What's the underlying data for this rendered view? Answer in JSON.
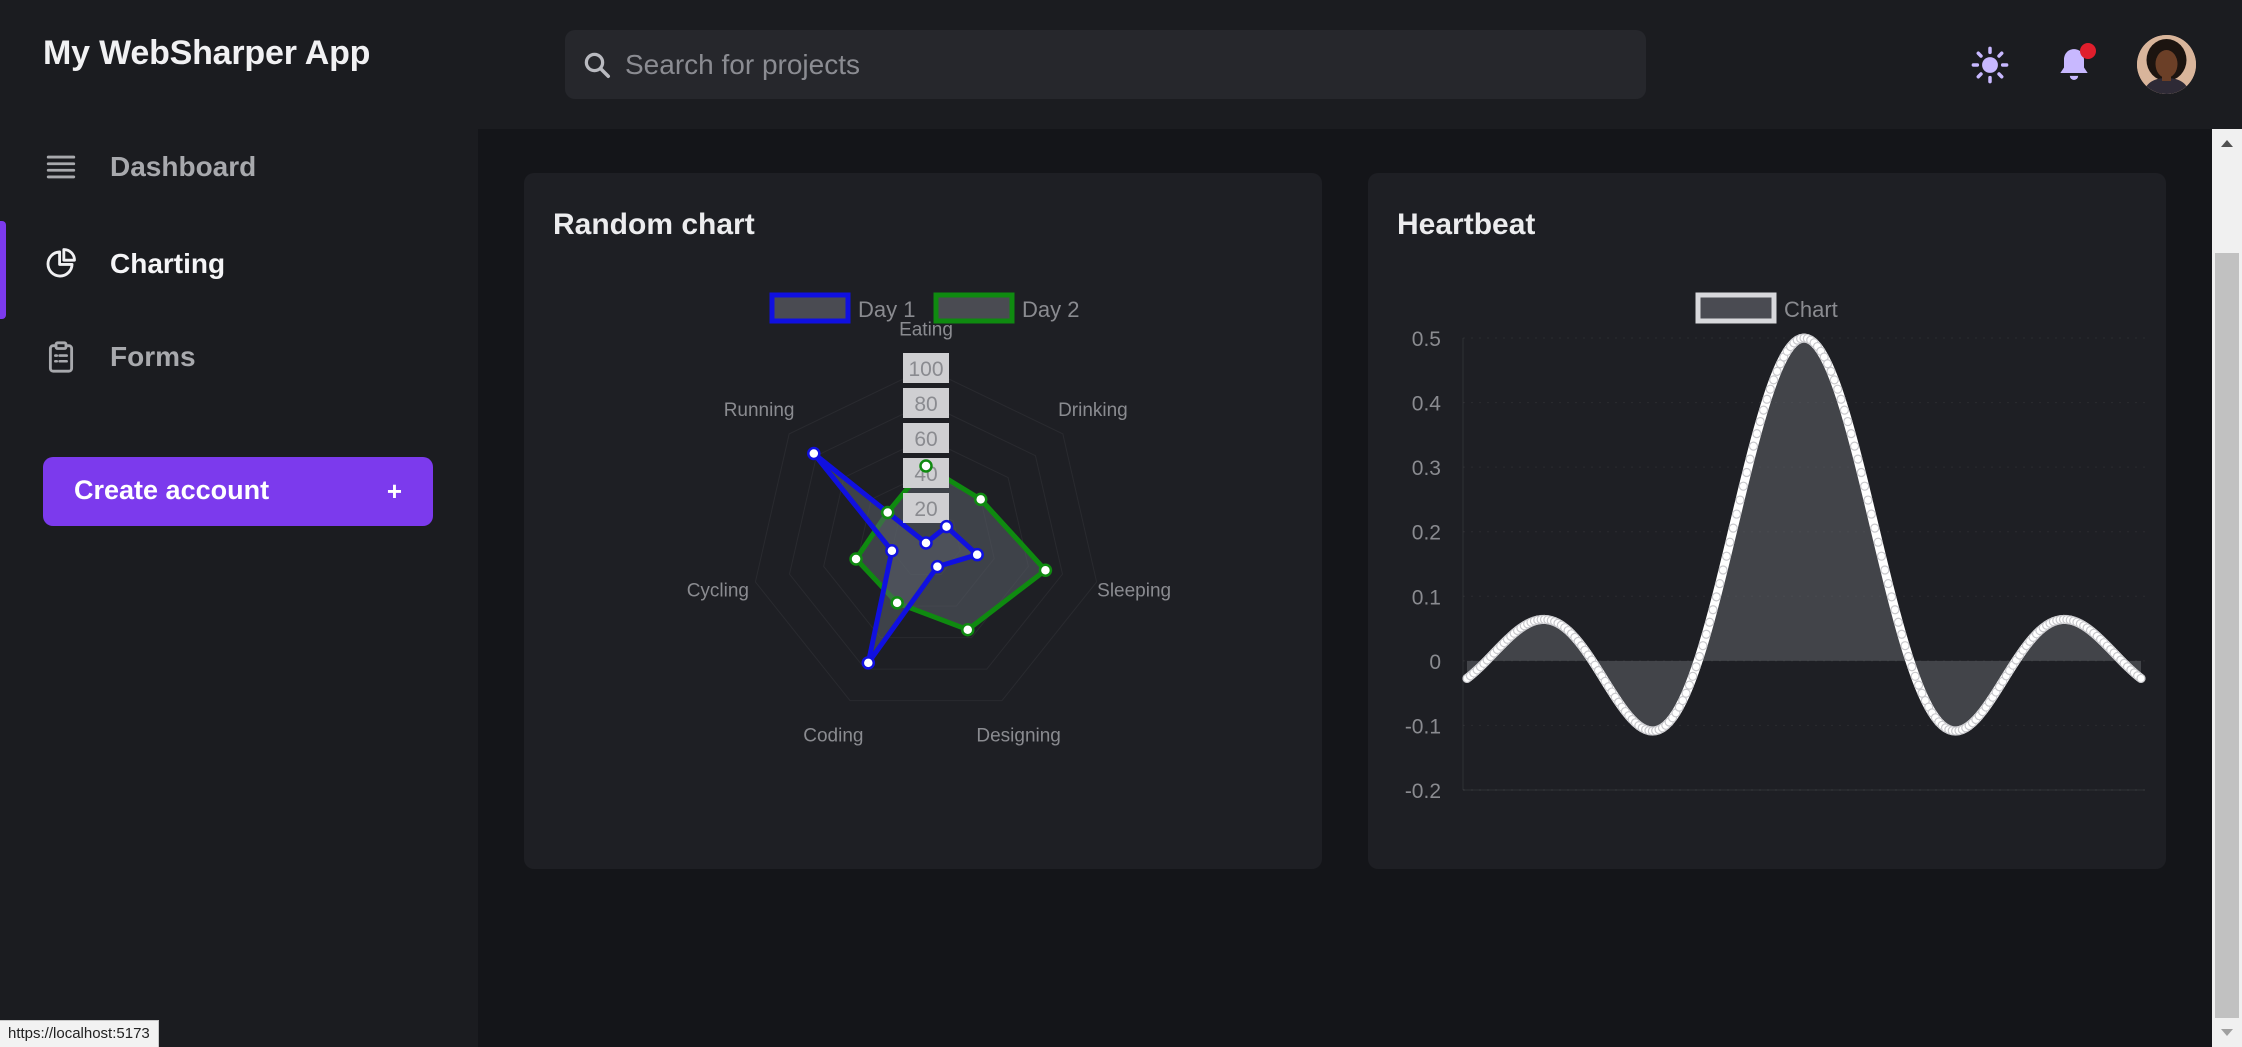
{
  "app": {
    "title": "My WebSharper App"
  },
  "search": {
    "placeholder": "Search for projects",
    "icon": "search-icon"
  },
  "header": {
    "theme_icon": "sun-icon",
    "notifications_icon": "bell-icon",
    "has_unread": true,
    "avatar": "user-avatar"
  },
  "sidebar": {
    "items": [
      {
        "label": "Dashboard",
        "icon": "menu-lines-icon",
        "active": false
      },
      {
        "label": "Charting",
        "icon": "pie-chart-icon",
        "active": true
      },
      {
        "label": "Forms",
        "icon": "clipboard-icon",
        "active": false
      }
    ],
    "create_button": {
      "label": "Create account",
      "plus": "+"
    }
  },
  "colors": {
    "accent": "#7c3aed",
    "day1": "#1010e0",
    "day2": "#0f8a10",
    "heartbeat": "#ffffff",
    "notification_dot": "#e01e2c"
  },
  "status_bar": {
    "url": "https://localhost:5173"
  },
  "chart_data": [
    {
      "type": "radar",
      "title": "Random chart",
      "categories": [
        "Eating",
        "Drinking",
        "Sleeping",
        "Designing",
        "Coding",
        "Cycling",
        "Running"
      ],
      "r_ticks": [
        "20",
        "40",
        "60",
        "80",
        "100"
      ],
      "r_range": [
        0,
        100
      ],
      "legend_position": "top",
      "series": [
        {
          "name": "Day 1",
          "values": [
            0,
            15,
            30,
            15,
            76,
            20,
            82
          ]
        },
        {
          "name": "Day 2",
          "values": [
            44,
            40,
            70,
            55,
            38,
            41,
            28
          ]
        }
      ]
    },
    {
      "type": "area",
      "title": "Heartbeat",
      "legend_position": "top",
      "series_name": "Chart",
      "y_ticks": [
        "0.5",
        "0.4",
        "0.3",
        "0.2",
        "0.1",
        "0",
        "-0.1",
        "-0.2"
      ],
      "ylim": [
        -0.2,
        0.5
      ],
      "function": "sinc(x)/2 sampled over x in [-10, 10]",
      "x_range": [
        -10,
        10
      ],
      "samples": 201
    }
  ]
}
